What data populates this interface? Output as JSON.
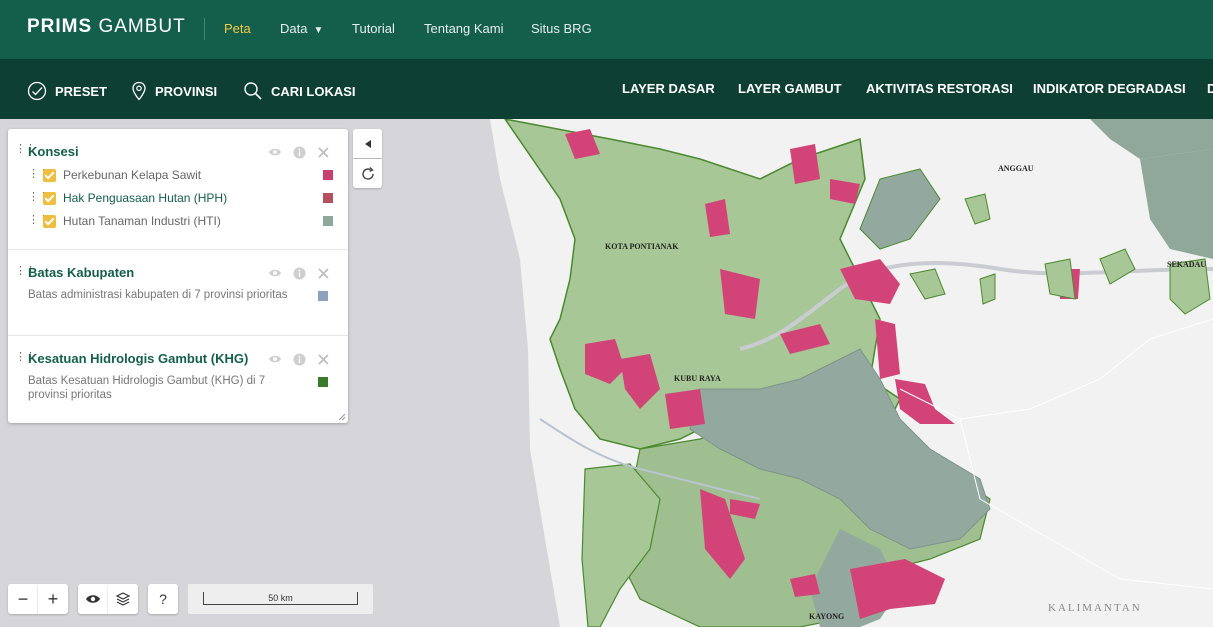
{
  "app": {
    "title_bold": "PRIMS",
    "title_light": "GAMBUT"
  },
  "topnav": [
    {
      "label": "Peta",
      "active": true
    },
    {
      "label": "Data"
    },
    {
      "label": "Tutorial"
    },
    {
      "label": "Tentang Kami"
    },
    {
      "label": "Situs BRG"
    }
  ],
  "toolbar": {
    "preset": "PRESET",
    "provinsi": "PROVINSI",
    "cari_lokasi": "CARI LOKASI",
    "layer_dasar": "LAYER DASAR",
    "layer_gambut": "LAYER GAMBUT",
    "aktivitas_restorasi": "AKTIVITAS RESTORASI",
    "indikator_degradasi": "INDIKATOR DEGRADASI",
    "more": "D"
  },
  "layers_panel": {
    "konsesi": {
      "title": "Konsesi",
      "items": [
        {
          "label": "Perkebunan Kelapa Sawit",
          "color": "#c8416e"
        },
        {
          "label": "Hak Penguasaan Hutan (HPH)",
          "color": "#b5505e"
        },
        {
          "label": "Hutan Tanaman Industri (HTI)",
          "color": "#8ea89b"
        }
      ]
    },
    "batas_kabupaten": {
      "title": "Batas Kabupaten",
      "description": "Batas administrasi kabupaten di 7 provinsi prioritas",
      "color": "#8ea3bd"
    },
    "khg": {
      "title": "Kesatuan Hidrologis Gambut (KHG)",
      "description": "Batas Kesatuan Hidrologis Gambut (KHG) di 7 provinsi prioritas",
      "color": "#3c7a2b"
    }
  },
  "map_labels": {
    "pontianak": "KOTA PONTIANAK",
    "kubu_raya": "KUBU RAYA",
    "anggau": "ANGGAU",
    "sekadau": "SEKADAU",
    "kayong": "KAYONG",
    "kalimantan": "KALIMANTAN"
  },
  "controls": {
    "zoom_out": "−",
    "zoom_in": "+",
    "help": "?",
    "scale": "50 km"
  }
}
